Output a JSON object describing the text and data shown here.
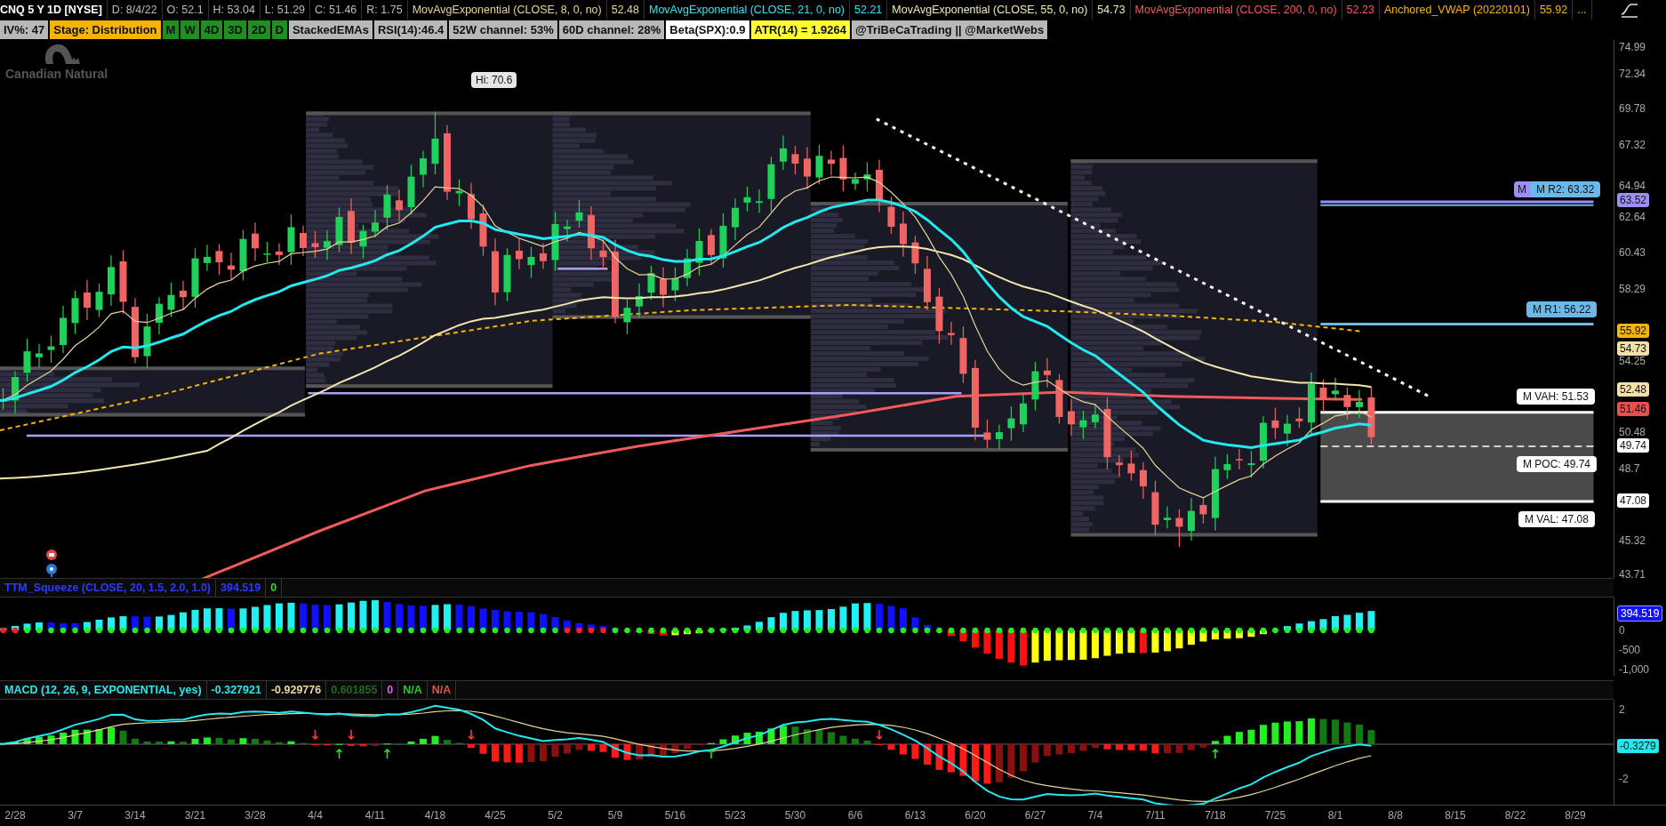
{
  "header": {
    "symbol": "CNQ 5 Y 1D [NYSE]",
    "quote": [
      "D: 8/4/22",
      "O: 52.1",
      "H: 53.04",
      "L: 51.29",
      "C: 51.46",
      "R: 1.75"
    ],
    "studies": [
      {
        "name": "MovAvgExponential (CLOSE, 8, 0, no)",
        "value": "52.48",
        "color": "#e8d49a"
      },
      {
        "name": "MovAvgExponential (CLOSE, 21, 0, no)",
        "value": "52.21",
        "color": "#2ee6f0"
      },
      {
        "name": "MovAvgExponential (CLOSE, 55, 0, no)",
        "value": "54.73",
        "color": "#f3e7b0"
      },
      {
        "name": "MovAvgExponential (CLOSE, 200, 0, no)",
        "value": "52.23",
        "color": "#f05a5a"
      },
      {
        "name": "Anchored_VWAP (20220101)",
        "value": "55.92",
        "color": "#f5b400"
      }
    ],
    "more": "..."
  },
  "badges": [
    {
      "text": "IV%: 47",
      "color": "#b8b8b8"
    },
    {
      "text": "Stage: Distribution",
      "color": "#f5b400"
    },
    {
      "text": "M",
      "color": "#1f8f1f"
    },
    {
      "text": "W",
      "color": "#1f8f1f"
    },
    {
      "text": "4D",
      "color": "#1f8f1f"
    },
    {
      "text": "3D",
      "color": "#1f8f1f"
    },
    {
      "text": "2D",
      "color": "#1f8f1f"
    },
    {
      "text": "D",
      "color": "#1f8f1f"
    },
    {
      "text": "StackedEMAs",
      "color": "#b8b8b8"
    },
    {
      "text": "RSI(14):46.4",
      "color": "#b8b8b8"
    },
    {
      "text": "52W channel: 53%",
      "color": "#b8b8b8"
    },
    {
      "text": "60D channel: 28%",
      "color": "#b8b8b8"
    },
    {
      "text": "Beta(SPX):0.9",
      "color": "#ffffff"
    },
    {
      "text": "ATR(14) = 1.9264",
      "color": "#ffff33"
    },
    {
      "text": "@TriBeCaTrading || @MarketWebs",
      "color": "#b8b8b8"
    }
  ],
  "price_chart": {
    "logo": "Canadian Natural",
    "high_callout": "Hi: 70.6",
    "levels": [
      {
        "label": "M",
        "color": "#9b8ff5"
      },
      {
        "label": "M R2: 63.32",
        "color": "#6cb8e8"
      },
      {
        "label": "M R1: 56.22",
        "color": "#6cb8e8"
      },
      {
        "label": "M VAH: 51.53",
        "color": "#ffffff"
      },
      {
        "label": "M POC: 49.74",
        "color": "#ffffff"
      },
      {
        "label": "M VAL: 47.08",
        "color": "#ffffff"
      }
    ],
    "axis_ticks": [
      "74.99",
      "72.34",
      "69.78",
      "67.32",
      "64.94",
      "62.64",
      "60.43",
      "58.29",
      "54.25",
      "50.48",
      "48.7",
      "45.32",
      "43.71"
    ],
    "price_tags": [
      {
        "text": "63.52",
        "color": "#9b8ff5"
      },
      {
        "text": "55.92",
        "color": "#f5b400"
      },
      {
        "text": "54.73",
        "color": "#f3e0a8"
      },
      {
        "text": "52.48",
        "color": "#f3e0a8"
      },
      {
        "text": "51.46",
        "color": "#e85050"
      },
      {
        "text": "49.74",
        "color": "#ffffff"
      },
      {
        "text": "47.08",
        "color": "#ffffff"
      }
    ]
  },
  "ttm_squeeze": {
    "header": [
      {
        "text": "TTM_Squeeze (CLOSE, 20, 1.5, 2.0, 1.0)",
        "color": "#2a3cff"
      },
      {
        "text": "394.519",
        "color": "#2a3cff"
      },
      {
        "text": "0",
        "color": "#22dd22"
      }
    ],
    "value_tag": "394.519",
    "axis_ticks": [
      "0",
      "-500",
      "-1,000"
    ]
  },
  "macd": {
    "header": [
      {
        "text": "MACD (12, 26, 9, EXPONENTIAL, yes)",
        "color": "#2ee6f0"
      },
      {
        "text": "-0.327921",
        "color": "#2ee6f0"
      },
      {
        "text": "-0.929776",
        "color": "#e8d49a"
      },
      {
        "text": "0.601855",
        "color": "#1c6b1c"
      },
      {
        "text": "0",
        "color": "#e060e0"
      },
      {
        "text": "N/A",
        "color": "#22cc22"
      },
      {
        "text": "N/A",
        "color": "#e85050"
      }
    ],
    "value_tag": "-0.3279",
    "axis_ticks": [
      "2",
      "-2"
    ]
  },
  "x_axis": [
    "2/28",
    "3/7",
    "3/14",
    "3/21",
    "3/28",
    "4/4",
    "4/11",
    "4/18",
    "4/25",
    "5/2",
    "5/9",
    "5/16",
    "5/23",
    "5/30",
    "6/6",
    "6/13",
    "6/20",
    "6/27",
    "7/4",
    "7/11",
    "7/18",
    "7/25",
    "8/1",
    "8/8",
    "8/15",
    "8/22",
    "8/29"
  ]
}
